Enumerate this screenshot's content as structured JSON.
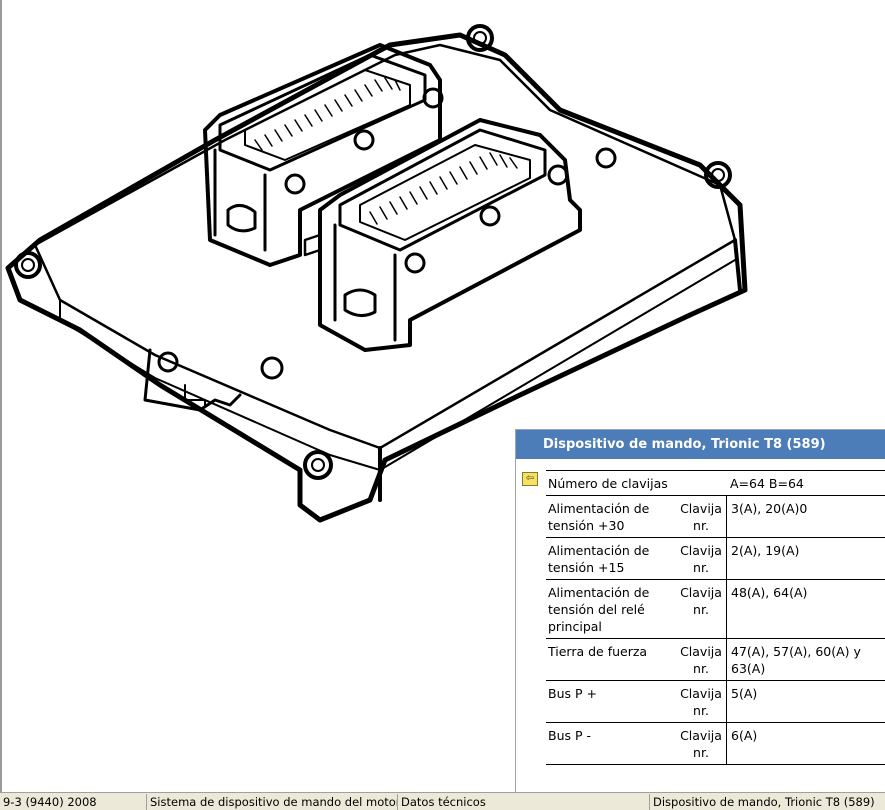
{
  "panel": {
    "title": "Dispositivo de mando, Trionic T8 (589)",
    "back_icon": "back-arrow-icon",
    "rows": [
      {
        "label": "Número de clavijas",
        "unit": "",
        "value": "A=64 B=64"
      },
      {
        "label": "Alimentación de tensión +30",
        "unit": "Clavija nr.",
        "value": "3(A), 20(A)0"
      },
      {
        "label": "Alimentación de tensión +15",
        "unit": "Clavija nr.",
        "value": "2(A), 19(A)"
      },
      {
        "label": "Alimentación de tensión del relé principal",
        "unit": "Clavija nr.",
        "value": "48(A), 64(A)"
      },
      {
        "label": "Tierra de fuerza",
        "unit": "Clavija nr.",
        "value": "47(A), 57(A), 60(A) y 63(A)"
      },
      {
        "label": "Bus P +",
        "unit": "Clavija nr.",
        "value": "5(A)"
      },
      {
        "label": "Bus P -",
        "unit": "Clavija nr.",
        "value": "6(A)"
      }
    ]
  },
  "statusbar": {
    "model": "9-3 (9440) 2008",
    "system": "Sistema de dispositivo de mando del motor",
    "section": "Datos técnicos",
    "component": "Dispositivo de mando, Trionic T8 (589)"
  }
}
